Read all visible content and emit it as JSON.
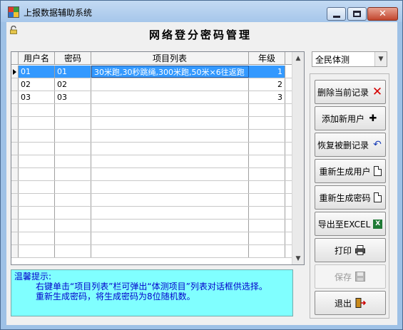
{
  "window": {
    "title": "上报数据辅助系统"
  },
  "header": {
    "title": "网络登分密码管理"
  },
  "grid": {
    "columns": [
      "用户名",
      "密码",
      "项目列表",
      "年级"
    ],
    "rows": [
      {
        "user": "01",
        "password": "01",
        "items": "30米跑,30秒跳绳,300米跑,50米×6往返跑",
        "grade": "1"
      },
      {
        "user": "02",
        "password": "02",
        "items": "",
        "grade": "2"
      },
      {
        "user": "03",
        "password": "03",
        "items": "",
        "grade": "3"
      }
    ],
    "selected_row": 0
  },
  "combo": {
    "value": "全民体测"
  },
  "buttons": {
    "delete": "删除当前记录",
    "add_user": "添加新用户",
    "restore": "恢复被删记录",
    "regen_user": "重新生成用户",
    "regen_pwd": "重新生成密码",
    "export": "导出至EXCEL",
    "print": "打印",
    "save": "保存",
    "exit": "退出"
  },
  "tip": {
    "title": "温馨提示:",
    "line1": "右键单击“项目列表”栏可弹出“体测项目”列表对话框供选择。",
    "line2": "重新生成密码，将生成密码为8位随机数。"
  },
  "icons": {
    "app": "app-icon",
    "lock": "lock-icon",
    "delete": "red-x-icon",
    "add": "plus-icon",
    "restore": "undo-arrow-icon",
    "document": "document-icon",
    "excel": "excel-icon",
    "print": "printer-icon",
    "save": "floppy-disk-icon",
    "exit": "exit-door-icon"
  },
  "colors": {
    "title_bar": "#a6c6ea",
    "selection": "#3399ff",
    "tip_background": "#80ffff",
    "tip_text": "#0000cc",
    "delete_icon": "#d40000"
  }
}
